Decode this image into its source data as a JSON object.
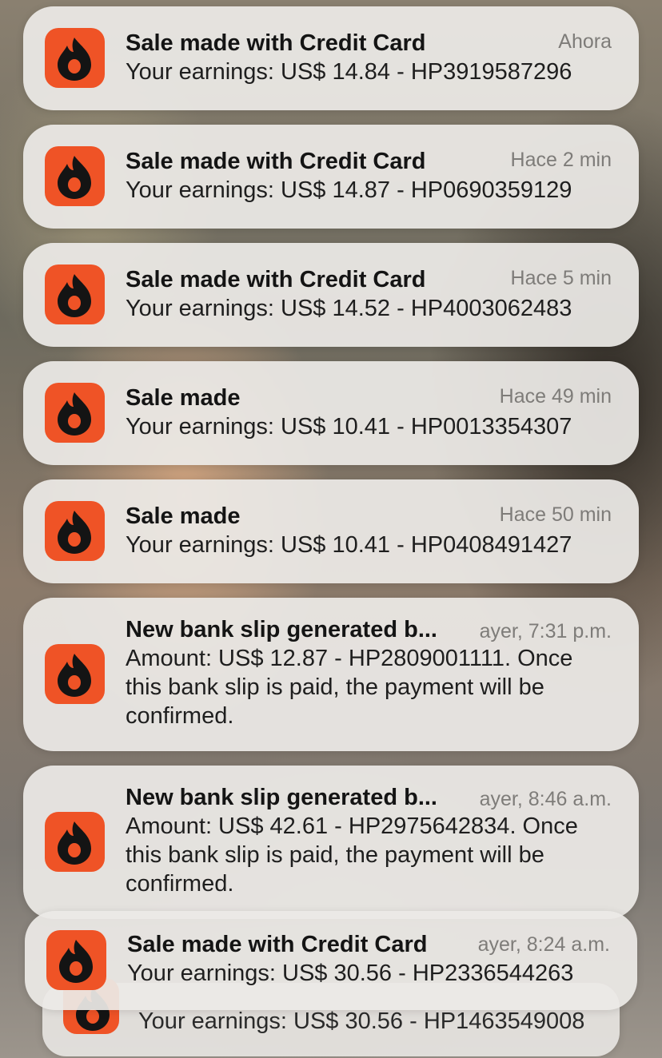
{
  "notifications": [
    {
      "title": "Sale made with Credit Card",
      "time": "Ahora",
      "body": "Your earnings: US$ 14.84 - HP3919587296"
    },
    {
      "title": "Sale made with Credit Card",
      "time": "Hace 2 min",
      "body": "Your earnings: US$ 14.87 - HP0690359129"
    },
    {
      "title": "Sale made with Credit Card",
      "time": "Hace 5 min",
      "body": "Your earnings: US$ 14.52 - HP4003062483"
    },
    {
      "title": "Sale made",
      "time": "Hace 49 min",
      "body": "Your earnings: US$ 10.41 - HP0013354307"
    },
    {
      "title": "Sale made",
      "time": "Hace 50 min",
      "body": "Your earnings: US$ 10.41 - HP0408491427"
    },
    {
      "title": "New bank slip generated b...",
      "time": "ayer, 7:31 p.m.",
      "body": "Amount: US$ 12.87 - HP2809001111. Once this bank slip is paid, the payment will be confirmed."
    },
    {
      "title": "New bank slip generated b...",
      "time": "ayer, 8:46 a.m.",
      "body": "Amount: US$ 42.61 - HP2975642834. Once this bank slip is paid, the payment will be confirmed."
    },
    {
      "title": "Sale made with Credit Card",
      "time": "ayer, 8:24 a.m.",
      "body": "Your earnings: US$ 30.56 - HP2336544263"
    }
  ],
  "stacked_notification": {
    "body": "Your earnings: US$ 30.56 - HP1463549008"
  },
  "app_icon": {
    "name": "flame-icon",
    "color": "#ef5326"
  }
}
